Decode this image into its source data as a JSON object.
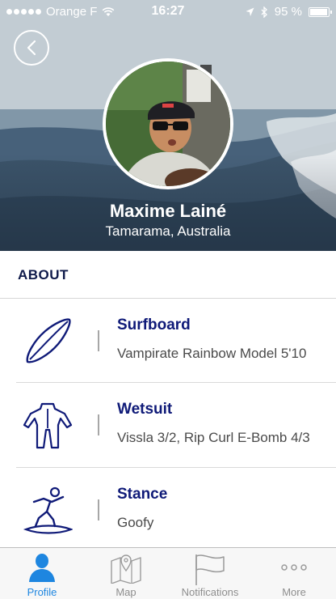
{
  "status_bar": {
    "carrier": "Orange F",
    "time": "16:27",
    "battery": "95 %"
  },
  "profile": {
    "name": "Maxime Lainé",
    "location": "Tamarama, Australia"
  },
  "about": {
    "title": "ABOUT",
    "items": [
      {
        "title": "Surfboard",
        "value": "Vampirate Rainbow Model 5'10",
        "icon": "surfboard-icon"
      },
      {
        "title": "Wetsuit",
        "value": "Vissla 3/2, Rip Curl E-Bomb 4/3",
        "icon": "wetsuit-icon"
      },
      {
        "title": "Stance",
        "value": "Goofy",
        "icon": "surfer-stance-icon"
      }
    ]
  },
  "tabbar": {
    "tabs": [
      {
        "label": "Profile",
        "icon": "person-icon",
        "active": true
      },
      {
        "label": "Map",
        "icon": "map-icon",
        "active": false
      },
      {
        "label": "Notifications",
        "icon": "flag-icon",
        "active": false
      },
      {
        "label": "More",
        "icon": "more-dots-icon",
        "active": false
      }
    ]
  },
  "colors": {
    "accent": "#1e86e0",
    "title_navy": "#0f1a78",
    "heading_navy": "#0f1a4a"
  }
}
